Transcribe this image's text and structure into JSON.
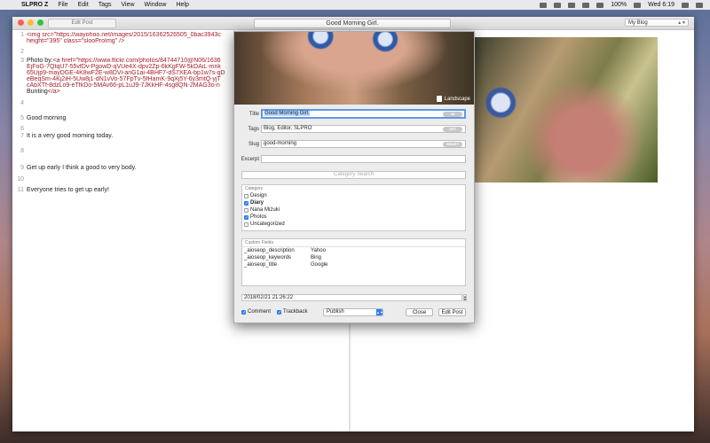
{
  "menubar": {
    "items": [
      "SLPRO Z",
      "File",
      "Edit",
      "Tags",
      "View",
      "Window",
      "Help"
    ],
    "battery": "100%",
    "clock": "Wed 6:19"
  },
  "window": {
    "edit_post_button": "Edit Post",
    "doc_title": "Good Morning Girl.",
    "blog_select": "My Blog"
  },
  "editor": {
    "lines": [
      {
        "num": "1",
        "text": "<img src=\"https://wayohoo.net/images/2015/16362526505_0bac3943c",
        "kind": "code"
      },
      {
        "num": "",
        "text": "height=\"395\" class=\"slooProImg\" />",
        "kind": "code"
      },
      {
        "num": "2",
        "text": "",
        "kind": "plain"
      },
      {
        "num": "3",
        "text": "Photo by: <a href=\"https://www.flickr.com/photos/84744710@N06/1636",
        "kind": "mixed",
        "prefix": "Photo by: ",
        "rest": "<a href=\"https://www.flickr.com/photos/84744710@N06/1636"
      },
      {
        "num": "",
        "text": "EjFoG-7QtqU7-55vfDv-PgowD-qVUe4X-dpv2Zp-6kKgFW-5kDAiL-mnk",
        "kind": "code"
      },
      {
        "num": "",
        "text": "65Ujp9-mayDGE-4K8wF2E-w8DVi-anG1ai-4BHF7-dS7XEA-bp1w7s-qD",
        "kind": "code"
      },
      {
        "num": "",
        "text": "eBeqSm-4Kj2iH-5Uw8j1-dN1vVo-57FpTv-5fHamK-9qXj5Y-6y3mtQ-yjT",
        "kind": "code"
      },
      {
        "num": "",
        "text": "cAbXTf-8dzLo9-eTfkDo-5MAv66-pL1uJ9-7JKkHF-4sg8QN-2MAG3o-n",
        "kind": "code"
      },
      {
        "num": "",
        "text": "Bunting</a>",
        "kind": "mixed",
        "prefix": "Bunting",
        "rest": "</a>"
      },
      {
        "num": "4",
        "text": "",
        "kind": "plain"
      },
      {
        "num": "5",
        "text": "Good morning",
        "kind": "plain"
      },
      {
        "num": "6",
        "text": "",
        "kind": "plain"
      },
      {
        "num": "7",
        "text": "It is a very good morning today.",
        "kind": "plain"
      },
      {
        "num": "8",
        "text": "",
        "kind": "plain"
      },
      {
        "num": "9",
        "text": "Get up early I think a good to very body.",
        "kind": "plain"
      },
      {
        "num": "10",
        "text": "",
        "kind": "plain"
      },
      {
        "num": "11",
        "text": "Everyone tries to get up early!",
        "kind": "plain"
      }
    ]
  },
  "dialog": {
    "landscape_label": "Landscape",
    "title_label": "Title",
    "title_value": "Good Morning Girl.",
    "title_pill": "18",
    "tags_label": "Tags",
    "tags_value": "Blog, Editor, SLPRO",
    "tags_pill": "SET",
    "slug_label": "Slug",
    "slug_value": "good-morning",
    "slug_pill": "SMART",
    "excerpt_label": "Excerpt",
    "category_search_placeholder": "Category Search",
    "category_header": "Category",
    "categories": [
      {
        "name": "Design",
        "checked": false,
        "bold": false
      },
      {
        "name": "Diary",
        "checked": true,
        "bold": true
      },
      {
        "name": "Nana Mizuki",
        "checked": false,
        "bold": false
      },
      {
        "name": "Photos",
        "checked": true,
        "bold": false
      },
      {
        "name": "Uncategorized",
        "checked": false,
        "bold": false
      }
    ],
    "custom_fields_header": "Custom Fields",
    "custom_fields": [
      {
        "key": "_aioseop_description",
        "value": "Yahoo"
      },
      {
        "key": "_aioseop_keywords",
        "value": "Bing"
      },
      {
        "key": "_aioseop_title",
        "value": "Google"
      }
    ],
    "date": "2018/02/21 21:26:22",
    "comment_label": "Comment",
    "trackback_label": "Trackback",
    "status_select": "Publish",
    "close_button": "Close",
    "edit_post_button": "Edit Post"
  },
  "colors": {
    "accent": "#2f7bf0",
    "code": "#a61c2a",
    "pill": "#c7c7c7"
  }
}
